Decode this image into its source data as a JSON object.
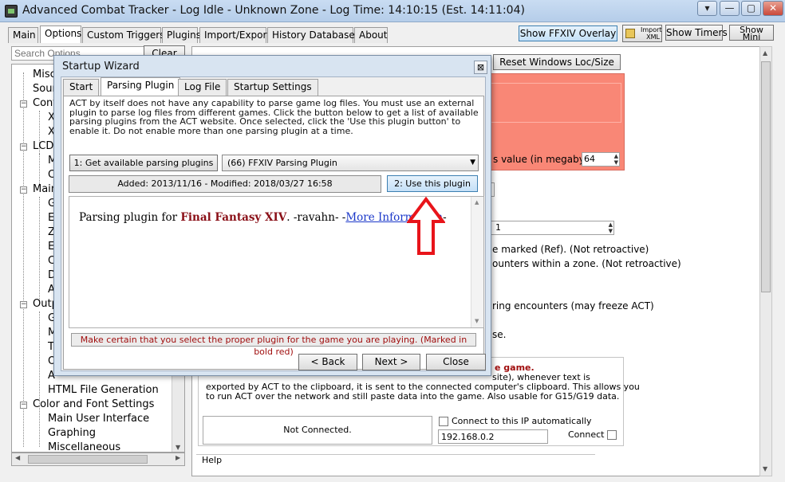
{
  "window": {
    "title": "Advanced Combat Tracker - Log Idle - Unknown Zone - Log Time: 14:10:15 (Est. 14:11:04)",
    "controls": [
      "▾",
      "—",
      "▢",
      "✕"
    ]
  },
  "main_tabs": [
    "Main",
    "Options",
    "Custom Triggers",
    "Plugins",
    "Import/Export",
    "History Database",
    "About"
  ],
  "toolbar": {
    "ffxiv_overlay": "Show FFXIV Overlay",
    "import_xml": "Import XML",
    "show_timers": "Show Timers",
    "show_mini": "Show Mini"
  },
  "search": {
    "placeholder": "Search Options",
    "clear": "Clear"
  },
  "tree": {
    "items": [
      "Misc",
      "Sour",
      "Confi",
      "XI",
      "XI",
      "LCD",
      "M",
      "C",
      "Main",
      "G",
      "E",
      "Z",
      "E",
      "C",
      "D",
      "A",
      "Outp",
      "G",
      "M",
      "T",
      "O",
      "A",
      "HTML File Generation",
      "Color and Font Settings",
      "Main User Interface",
      "Graphing",
      "Miscellaneous"
    ]
  },
  "right": {
    "reset_windows": "Reset Windows Loc/Size",
    "megabytes_label": "s value (in megabytes",
    "megabytes_value": "64",
    "spin_value": "1",
    "line1": "e marked (Ref).  (Not retroactive)",
    "line2": "ounters within a zone.  (Not retroactive)",
    "line3": "ring encounters (may freeze ACT)",
    "line4": "se.",
    "game_label": "e game.",
    "clip_line1": "site), whenever text is",
    "clip_line2": "exported by ACT to the clipboard, it is sent to the connected computer's clipboard.  This allows you",
    "clip_line3": "to run ACT over the network and still paste data into the game.  Also usable for G15/G19 data.",
    "not_connected": "Not Connected.",
    "connect_auto": "Connect to this IP automatically",
    "ip": "192.168.0.2",
    "connect": "Connect",
    "help": "Help"
  },
  "wizard": {
    "title": "Startup Wizard",
    "close": "⊠",
    "tabs": [
      "Start",
      "Parsing Plugin",
      "Log File",
      "Startup Settings"
    ],
    "description": "ACT by itself does not have any capability to parse game log files.  You must use an external plugin to parse log files from different games.  Click the button below to get a list of available parsing plugins from the ACT website.  Once selected, click the 'Use this plugin button' to enable it.  Do not enable more than one parsing plugin at a time.",
    "get_plugins": "1: Get available parsing plugins",
    "selected_plugin": "(66) FFXIV Parsing Plugin",
    "added_modified": "Added: 2013/11/16 - Modified: 2018/03/27 16:58",
    "use_plugin": "2: Use this plugin",
    "info_prefix": "Parsing plugin for ",
    "info_game": "Final Fantasy XIV",
    "info_author": ". -ravahn- -",
    "info_link": "More Information",
    "info_suffix": "-",
    "warning": "Make certain that you select the proper plugin for the game you are playing.  (Marked in bold red)",
    "back": "< Back",
    "next": "Next >",
    "close_btn": "Close"
  },
  "colors": {
    "salmon": "#f98776",
    "warning_red": "#a00e0e",
    "arrow_red": "#e8141a",
    "link_blue": "#1a37c9"
  }
}
